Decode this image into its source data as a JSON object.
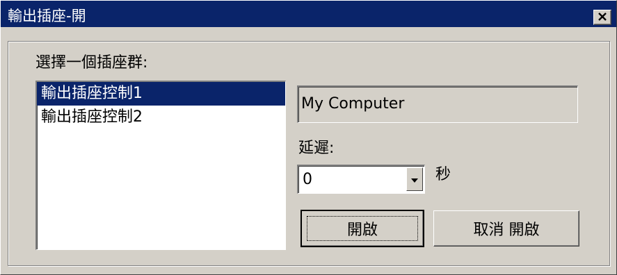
{
  "window": {
    "title": "輸出插座-開",
    "close_icon": "close-icon"
  },
  "group": {
    "label": "選擇一個插座群:"
  },
  "outlet_list": {
    "items": [
      {
        "label": "輸出插座控制1",
        "selected": true
      },
      {
        "label": "輸出插座控制2",
        "selected": false
      }
    ]
  },
  "computer": {
    "value": "My Computer"
  },
  "delay": {
    "label": "延遲:",
    "value": "0",
    "unit": "秒",
    "arrow_icon": "chevron-down-icon"
  },
  "buttons": {
    "open": "開啟",
    "cancel_open": "取消 開啟"
  },
  "colors": {
    "titlebar": "#0a246a",
    "selection": "#0a246a",
    "face": "#d4d0c8"
  }
}
